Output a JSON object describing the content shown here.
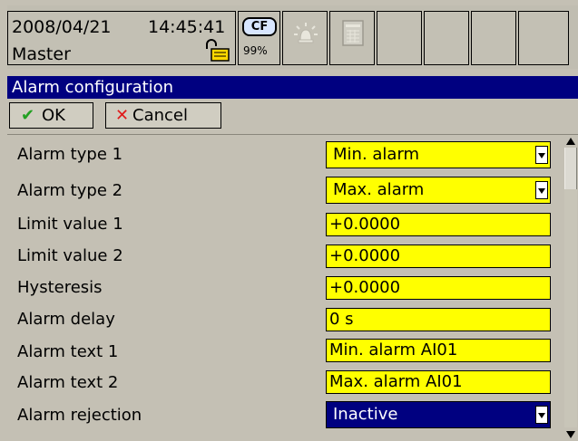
{
  "status_bar": {
    "date": "2008/04/21",
    "time": "14:45:41",
    "user": "Master",
    "storage_label": "CF",
    "storage_percent": "99%",
    "icons": [
      "lock-icon",
      "bell-icon",
      "document-icon"
    ]
  },
  "window": {
    "title": "Alarm configuration"
  },
  "toolbar": {
    "ok_label": "OK",
    "cancel_label": "Cancel"
  },
  "rows": [
    {
      "label": "Alarm type 1",
      "value": "Min. alarm",
      "kind": "dropdown"
    },
    {
      "label": "Alarm type 2",
      "value": "Max. alarm",
      "kind": "dropdown"
    },
    {
      "label": "Limit value 1",
      "value": "+0.0000",
      "kind": "text"
    },
    {
      "label": "Limit value 2",
      "value": "+0.0000",
      "kind": "text"
    },
    {
      "label": "Hysteresis",
      "value": "+0.0000",
      "kind": "text"
    },
    {
      "label": "Alarm delay",
      "value": "0 s",
      "kind": "text"
    },
    {
      "label": "Alarm text 1",
      "value": "Min. alarm AI01",
      "kind": "text"
    },
    {
      "label": "Alarm text 2",
      "value": "Max. alarm AI01",
      "kind": "text"
    },
    {
      "label": "Alarm rejection",
      "value": "Inactive",
      "kind": "dropdown",
      "selected": true
    }
  ],
  "colors": {
    "background": "#c4c0b4",
    "title_bar": "#000080",
    "field": "#ffff00",
    "selected_field": "#000080",
    "ok_check": "#21a021",
    "cancel_x": "#e01818"
  }
}
